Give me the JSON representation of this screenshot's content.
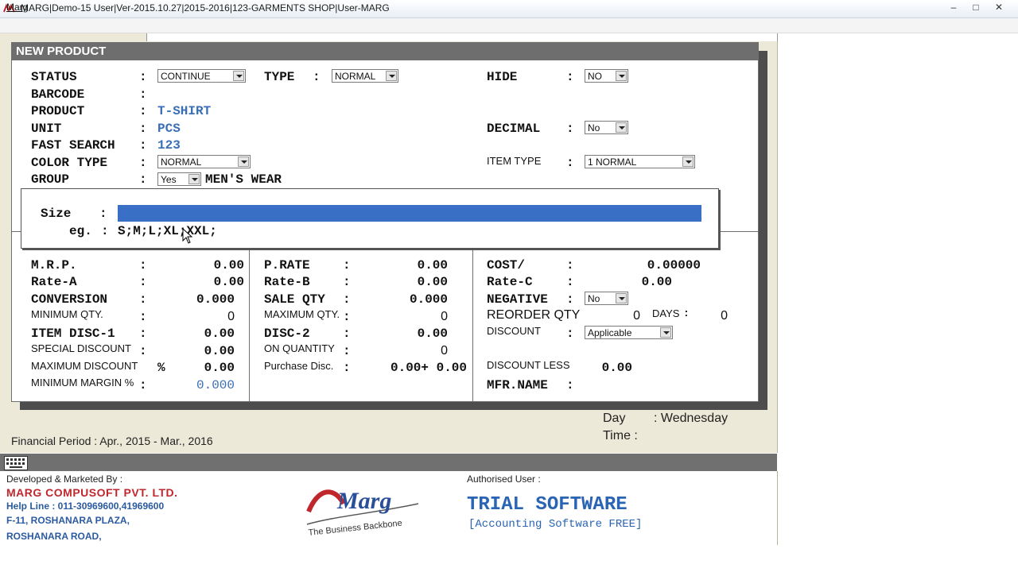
{
  "window": {
    "title": "MARG|Demo-15 User|Ver-2015.10.27|2015-2016|123-GARMENTS SHOP|User-MARG",
    "minimize": "–",
    "maximize": "□",
    "close": "✕"
  },
  "menu": {
    "marg": "Marg"
  },
  "dialog": {
    "title": "NEW PRODUCT",
    "fields": {
      "status": {
        "label": "STATUS",
        "value": "CONTINUE"
      },
      "type": {
        "label": "TYPE",
        "value": "NORMAL"
      },
      "hide": {
        "label": "HIDE",
        "value": "NO"
      },
      "barcode": {
        "label": "BARCODE",
        "value": ""
      },
      "product": {
        "label": "PRODUCT",
        "value": "T-SHIRT"
      },
      "unit": {
        "label": "UNIT",
        "value": "PCS"
      },
      "decimal": {
        "label": "DECIMAL",
        "value": "No"
      },
      "fast_search": {
        "label": "FAST SEARCH",
        "value": "123"
      },
      "color_type": {
        "label": "COLOR TYPE",
        "value": "NORMAL"
      },
      "item_type": {
        "label": "ITEM TYPE",
        "value": "1 NORMAL"
      },
      "group": {
        "label": "GROUP",
        "select": "Yes",
        "value": "MEN'S WEAR"
      }
    },
    "size_popup": {
      "label": "Size",
      "value": "",
      "example_label": "eg.",
      "example": "S;M;L;XL;XXL;"
    },
    "rates": {
      "mrp": {
        "label": "M.R.P.",
        "value": "0.00"
      },
      "rate_a": {
        "label": "Rate-A",
        "value": "0.00"
      },
      "conversion": {
        "label": "CONVERSION",
        "value": "0.000"
      },
      "minimum_qty": {
        "label": "MINIMUM QTY.",
        "value": "0"
      },
      "item_disc_1": {
        "label": "ITEM DISC-1",
        "value": "0.00"
      },
      "special_discount": {
        "label": "SPECIAL DISCOUNT",
        "value": "0.00"
      },
      "maximum_discount": {
        "label": "MAXIMUM DISCOUNT",
        "unit": "%",
        "value": "0.00"
      },
      "minimum_margin": {
        "label": "MINIMUM MARGIN %",
        "value": "0.000"
      },
      "p_rate": {
        "label": "P.RATE",
        "value": "0.00"
      },
      "rate_b": {
        "label": "Rate-B",
        "value": "0.00"
      },
      "sale_qty": {
        "label": "SALE QTY",
        "value": "0.000"
      },
      "maximum_qty": {
        "label": "MAXIMUM QTY.",
        "value": "0"
      },
      "disc_2": {
        "label": "DISC-2",
        "value": "0.00"
      },
      "on_quantity": {
        "label": "ON QUANTITY",
        "value": "0"
      },
      "purchase_disc": {
        "label": "Purchase Disc.",
        "value": "0.00+ 0.00"
      },
      "cost": {
        "label": "COST/",
        "value": "0.00000"
      },
      "rate_c": {
        "label": "Rate-C",
        "value": "0.00"
      },
      "negative": {
        "label": "NEGATIVE",
        "value": "No"
      },
      "reorder_qty": {
        "label": "REORDER QTY",
        "value": "0",
        "days_label": "DAYS",
        "days_value": "0"
      },
      "discount": {
        "label": "DISCOUNT",
        "value": "Applicable"
      },
      "discount_less": {
        "label": "DISCOUNT LESS",
        "value": "0.00"
      },
      "mfr_name": {
        "label": "MFR.NAME",
        "value": ""
      }
    }
  },
  "workspace": {
    "financial_period": "Financial Period : Apr., 2015 - Mar., 2016",
    "day_label": "Day",
    "day_value": ": Wednesday",
    "time_label": "Time :"
  },
  "footer": {
    "developed_by": "Developed & Marketed By :",
    "company": "MARG COMPUSOFT PVT. LTD.",
    "helpline": "Help Line : 011-30969600,41969600",
    "address1": "F-11, ROSHANARA PLAZA,",
    "address2": "ROSHANARA ROAD,",
    "logo_text": "Marg",
    "logo_tagline": "The Business Backbone",
    "authorised_user_label": "Authorised User :",
    "trial": "TRIAL SOFTWARE",
    "trial_sub": "[Accounting Software FREE]"
  },
  "colors": {
    "accent_blue": "#3a6fc6",
    "value_blue": "#3a6fb5",
    "brand_red": "#c0272d"
  }
}
